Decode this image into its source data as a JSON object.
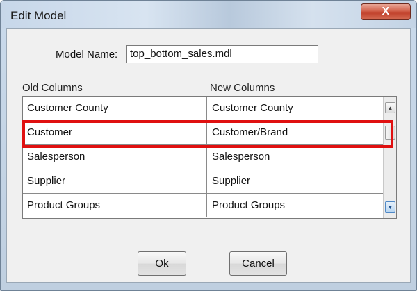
{
  "window": {
    "title": "Edit Model",
    "close_glyph": "X"
  },
  "model": {
    "name_label": "Model Name:",
    "name_value": "top_bottom_sales.mdl"
  },
  "columns": {
    "old_header": "Old Columns",
    "new_header": "New Columns",
    "rows": [
      {
        "old": "Customer County",
        "new": "Customer County"
      },
      {
        "old": "Customer",
        "new": "Customer/Brand"
      },
      {
        "old": "Salesperson",
        "new": "Salesperson"
      },
      {
        "old": "Supplier",
        "new": "Supplier"
      },
      {
        "old": "Product Groups",
        "new": "Product Groups"
      }
    ],
    "highlighted_row_index": 1
  },
  "buttons": {
    "ok_label": "Ok",
    "cancel_label": "Cancel"
  },
  "icons": {
    "close": "close-icon",
    "scroll_up": "scroll-up-arrow-icon",
    "scroll_down": "scroll-down-arrow-icon"
  },
  "colors": {
    "highlight": "#e01010",
    "close_button": "#c0402a"
  }
}
